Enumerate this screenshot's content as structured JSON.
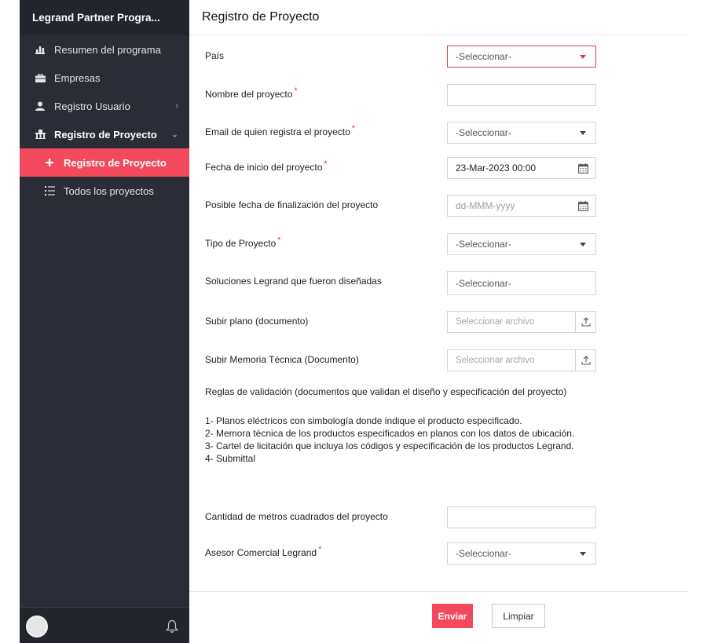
{
  "sidebar": {
    "brand": "Legrand Partner Progra...",
    "items": [
      {
        "label": "Resumen del programa",
        "icon": "bar-chart-icon"
      },
      {
        "label": "Empresas",
        "icon": "briefcase-icon"
      },
      {
        "label": "Registro Usuario",
        "icon": "user-icon",
        "chevron": "›"
      },
      {
        "label": "Registro de Proyecto",
        "icon": "building-icon",
        "chevron": "⌄"
      },
      {
        "label": "Registro de Proyecto",
        "icon": "plus-icon",
        "active": true
      },
      {
        "label": "Todos los proyectos",
        "icon": "list-icon"
      }
    ],
    "footer": {
      "avatar": "avatar",
      "bell_icon": "bell-icon"
    }
  },
  "header": {
    "title": "Registro de Proyecto"
  },
  "form": {
    "fields": [
      {
        "label": "País",
        "required": false,
        "value": "-Seleccionar-"
      },
      {
        "label": "Nombre del proyecto",
        "required": true,
        "value": ""
      },
      {
        "label": "Email de quien registra el proyecto",
        "required": true,
        "value": "-Seleccionar-"
      },
      {
        "label": "Fecha de inicio del proyecto",
        "required": true,
        "value": "23-Mar-2023 00:00"
      },
      {
        "label": "Posible fecha de finalización del proyecto",
        "required": false,
        "placeholder": "dd-MMM-yyyy"
      },
      {
        "label": "Tipo de Proyecto",
        "required": true,
        "value": "-Seleccionar-"
      },
      {
        "label": "Soluciones Legrand que fueron diseñadas",
        "required": false,
        "value": "-Seleccionar-"
      },
      {
        "label": "Subir plano (documento)",
        "required": false,
        "placeholder": "Seleccionar archivo"
      },
      {
        "label": "Subir Memoria Técnica (Documento)",
        "required": false,
        "placeholder": "Seleccionar archivo"
      },
      {
        "label": "Cantidad de metros cuadrados del proyecto",
        "required": false,
        "value": ""
      },
      {
        "label": "Asesor Comercial Legrand",
        "required": true,
        "value": "-Seleccionar-"
      }
    ],
    "required_mark": "*",
    "rules": {
      "title": "Reglas de validación (documentos que validan el diseño y especificación del proyecto)",
      "lines": [
        "1- Planos eléctricos con simbología donde indique el producto especificado.",
        "2- Memora técnica de los productos especificados en planos con los datos de ubicación.",
        "3- Cartel de licitación que incluya los códigos y especificación de los productos Legrand.",
        "4- Submittal"
      ]
    },
    "buttons": {
      "submit": "Enviar",
      "reset": "Limpiar"
    }
  },
  "colors": {
    "accent": "#f24a5c",
    "sidebar_bg": "#2a2d36",
    "error_border": "#e8334a"
  }
}
